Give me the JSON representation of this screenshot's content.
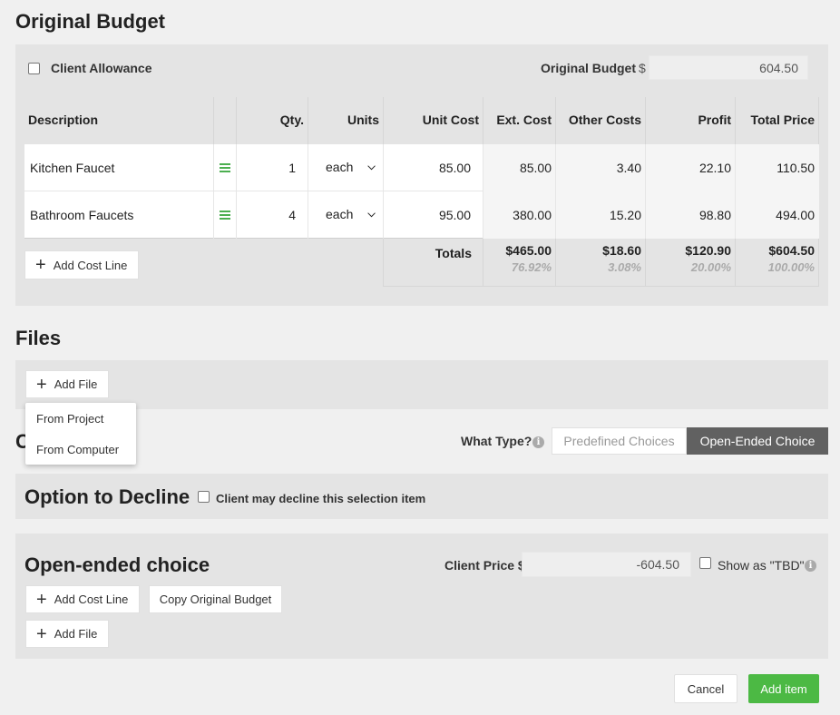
{
  "original_budget": {
    "title": "Original Budget",
    "client_allowance_label": "Client Allowance",
    "budget_label": "Original Budget",
    "currency": "$",
    "budget_value": "604.50",
    "columns": [
      "Description",
      "Qty.",
      "Units",
      "Unit Cost",
      "Ext. Cost",
      "Other Costs",
      "Profit",
      "Total Price"
    ],
    "rows": [
      {
        "description": "Kitchen Faucet",
        "qty": "1",
        "units": "each",
        "unit_cost": "85.00",
        "ext_cost": "85.00",
        "other_costs": "3.40",
        "profit": "22.10",
        "total_price": "110.50"
      },
      {
        "description": "Bathroom Faucets",
        "qty": "4",
        "units": "each",
        "unit_cost": "95.00",
        "ext_cost": "380.00",
        "other_costs": "15.20",
        "profit": "98.80",
        "total_price": "494.00"
      }
    ],
    "totals_label": "Totals",
    "totals": {
      "ext_cost": "$465.00",
      "other_costs": "$18.60",
      "profit": "$120.90",
      "total_price": "$604.50"
    },
    "percents": {
      "ext_cost": "76.92%",
      "other_costs": "3.08%",
      "profit": "20.00%",
      "total_price": "100.00%"
    },
    "add_cost_line": "Add Cost Line"
  },
  "files": {
    "title": "Files",
    "add_file": "Add File",
    "dropdown": [
      "From Project",
      "From Computer"
    ]
  },
  "choice": {
    "title_partial": "C",
    "what_type_label": "What Type?",
    "predefined": "Predefined Choices",
    "open_ended": "Open-Ended Choice"
  },
  "decline": {
    "title": "Option to Decline",
    "checkbox_label": "Client may decline this selection item"
  },
  "open_ended": {
    "title": "Open-ended choice",
    "client_price_label": "Client Price $",
    "client_price_value": "-604.50",
    "show_tbd_label": "Show as \"TBD\"",
    "add_cost_line": "Add Cost Line",
    "copy_budget": "Copy Original Budget",
    "add_file": "Add File"
  },
  "footer": {
    "cancel": "Cancel",
    "add_item": "Add item"
  },
  "colors": {
    "accent_green": "#4cb944",
    "active_toggle": "#616161"
  }
}
